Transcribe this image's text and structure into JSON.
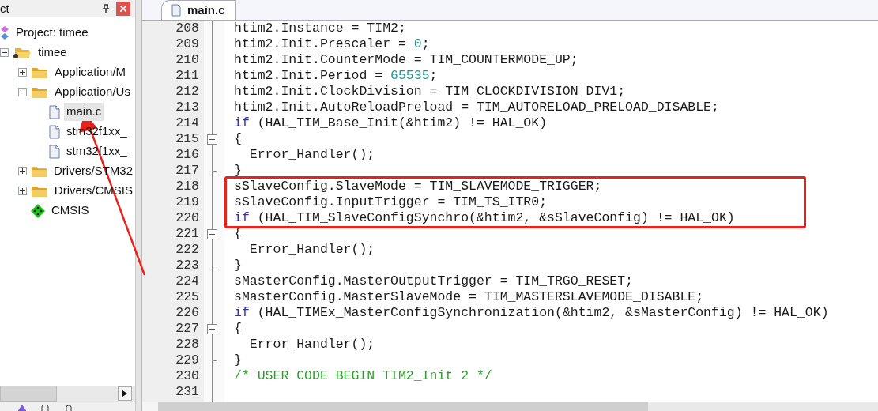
{
  "project_panel": {
    "title": "ct",
    "tree": [
      {
        "label": "Project: timee",
        "kind": "project",
        "selected": false,
        "children": [
          {
            "label": "timee",
            "kind": "target",
            "expanded": true,
            "selected": false,
            "children": [
              {
                "label": "Application/M",
                "kind": "folder",
                "expanded": false,
                "selected": false
              },
              {
                "label": "Application/Us",
                "kind": "folder",
                "expanded": true,
                "selected": false,
                "children": [
                  {
                    "label": "main.c",
                    "kind": "file",
                    "selected": true
                  },
                  {
                    "label": "stm32f1xx_",
                    "kind": "file",
                    "selected": false
                  },
                  {
                    "label": "stm32f1xx_",
                    "kind": "file",
                    "selected": false
                  }
                ]
              },
              {
                "label": "Drivers/STM32",
                "kind": "folder",
                "expanded": false,
                "selected": false
              },
              {
                "label": "Drivers/CMSIS",
                "kind": "folder",
                "expanded": false,
                "selected": false
              },
              {
                "label": "CMSIS",
                "kind": "component",
                "selected": false
              }
            ]
          }
        ]
      }
    ]
  },
  "editor": {
    "tabs": [
      {
        "label": "main.c",
        "selected": true
      }
    ],
    "lines": [
      {
        "number": "208",
        "kind": "plain",
        "annotated": false,
        "segments": [
          {
            "kind": "plain",
            "text": "htim2.Instance = TIM2;"
          }
        ]
      },
      {
        "number": "209",
        "kind": "plain",
        "annotated": false,
        "segments": [
          {
            "kind": "plain",
            "text": "htim2.Init.Prescaler = "
          },
          {
            "kind": "number",
            "text": "0"
          },
          {
            "kind": "plain",
            "text": ";"
          }
        ]
      },
      {
        "number": "210",
        "kind": "plain",
        "annotated": false,
        "segments": [
          {
            "kind": "plain",
            "text": "htim2.Init.CounterMode = TIM_COUNTERMODE_UP;"
          }
        ]
      },
      {
        "number": "211",
        "kind": "plain",
        "annotated": false,
        "segments": [
          {
            "kind": "plain",
            "text": "htim2.Init.Period = "
          },
          {
            "kind": "number",
            "text": "65535"
          },
          {
            "kind": "plain",
            "text": ";"
          }
        ]
      },
      {
        "number": "212",
        "kind": "plain",
        "annotated": false,
        "segments": [
          {
            "kind": "plain",
            "text": "htim2.Init.ClockDivision = TIM_CLOCKDIVISION_DIV1;"
          }
        ]
      },
      {
        "number": "213",
        "kind": "plain",
        "annotated": false,
        "segments": [
          {
            "kind": "plain",
            "text": "htim2.Init.AutoReloadPreload = TIM_AUTORELOAD_PRELOAD_DISABLE;"
          }
        ]
      },
      {
        "number": "214",
        "kind": "plain",
        "annotated": false,
        "segments": [
          {
            "kind": "keyword",
            "text": "if"
          },
          {
            "kind": "plain",
            "text": " (HAL_TIM_Base_Init(&htim2) != HAL_OK)"
          }
        ]
      },
      {
        "number": "215",
        "kind": "fold_start",
        "annotated": false,
        "segments": [
          {
            "kind": "plain",
            "text": "{"
          }
        ]
      },
      {
        "number": "216",
        "kind": "plain",
        "annotated": false,
        "segments": [
          {
            "kind": "plain",
            "text": "  Error_Handler();"
          }
        ]
      },
      {
        "number": "217",
        "kind": "fold_end",
        "annotated": false,
        "segments": [
          {
            "kind": "plain",
            "text": "}"
          }
        ]
      },
      {
        "number": "218",
        "kind": "plain",
        "annotated": true,
        "segments": [
          {
            "kind": "plain",
            "text": "sSlaveConfig.SlaveMode = TIM_SLAVEMODE_TRIGGER;"
          }
        ]
      },
      {
        "number": "219",
        "kind": "plain",
        "annotated": true,
        "segments": [
          {
            "kind": "plain",
            "text": "sSlaveConfig.InputTrigger = TIM_TS_ITR0;"
          }
        ]
      },
      {
        "number": "220",
        "kind": "plain",
        "annotated": true,
        "segments": [
          {
            "kind": "keyword",
            "text": "if"
          },
          {
            "kind": "plain",
            "text": " (HAL_TIM_SlaveConfigSynchro(&htim2, &sSlaveConfig) != HAL_OK)"
          }
        ]
      },
      {
        "number": "221",
        "kind": "fold_start",
        "annotated": false,
        "segments": [
          {
            "kind": "plain",
            "text": "{"
          }
        ]
      },
      {
        "number": "222",
        "kind": "plain",
        "annotated": false,
        "segments": [
          {
            "kind": "plain",
            "text": "  Error_Handler();"
          }
        ]
      },
      {
        "number": "223",
        "kind": "fold_end",
        "annotated": false,
        "segments": [
          {
            "kind": "plain",
            "text": "}"
          }
        ]
      },
      {
        "number": "224",
        "kind": "plain",
        "annotated": false,
        "segments": [
          {
            "kind": "plain",
            "text": "sMasterConfig.MasterOutputTrigger = TIM_TRGO_RESET;"
          }
        ]
      },
      {
        "number": "225",
        "kind": "plain",
        "annotated": false,
        "segments": [
          {
            "kind": "plain",
            "text": "sMasterConfig.MasterSlaveMode = TIM_MASTERSLAVEMODE_DISABLE;"
          }
        ]
      },
      {
        "number": "226",
        "kind": "plain",
        "annotated": false,
        "segments": [
          {
            "kind": "keyword",
            "text": "if"
          },
          {
            "kind": "plain",
            "text": " (HAL_TIMEx_MasterConfigSynchronization(&htim2, &sMasterConfig) != HAL_OK)"
          }
        ]
      },
      {
        "number": "227",
        "kind": "fold_start",
        "annotated": false,
        "segments": [
          {
            "kind": "plain",
            "text": "{"
          }
        ]
      },
      {
        "number": "228",
        "kind": "plain",
        "annotated": false,
        "segments": [
          {
            "kind": "plain",
            "text": "  Error_Handler();"
          }
        ]
      },
      {
        "number": "229",
        "kind": "fold_end",
        "annotated": false,
        "segments": [
          {
            "kind": "plain",
            "text": "}"
          }
        ]
      },
      {
        "number": "230",
        "kind": "plain",
        "annotated": false,
        "segments": [
          {
            "kind": "comment",
            "text": "/* USER CODE BEGIN TIM2_Init 2 */"
          }
        ]
      },
      {
        "number": "231",
        "kind": "plain",
        "annotated": false
      }
    ]
  }
}
